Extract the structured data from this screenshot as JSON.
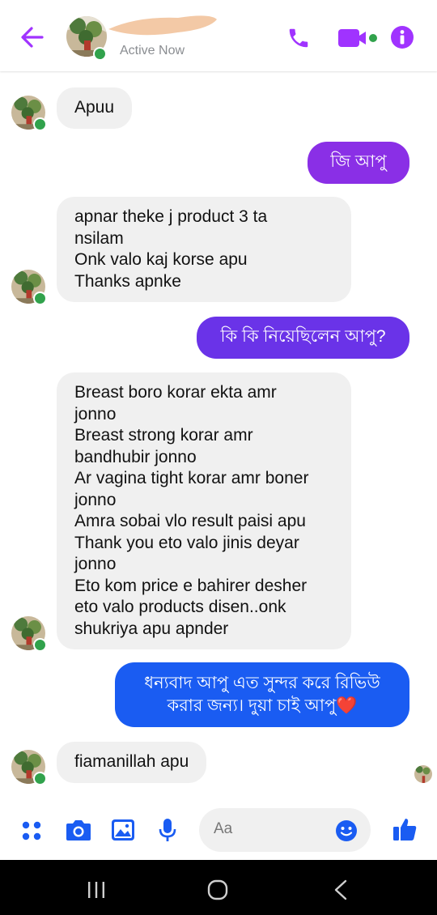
{
  "header": {
    "status": "Active Now"
  },
  "messages": [
    {
      "text": "Apuu"
    },
    {
      "text": "জি আপু"
    },
    {
      "text": "apnar theke j product 3 ta\nnsilam\nOnk valo kaj korse apu\nThanks apnke"
    },
    {
      "text": "কি কি নিয়েছিলেন আপু?"
    },
    {
      "text": "Breast boro korar ekta amr\njonno\nBreast strong korar amr\nbandhubir jonno\nAr vagina tight korar amr boner\njonno\nAmra sobai vlo result paisi apu\nThank you eto valo jinis deyar\njonno\nEto kom price e bahirer desher\neto valo products disen..onk\nshukriya apu apnder"
    },
    {
      "text": "ধন্যবাদ আপু এত সুন্দর করে রিভিউ\nকরার জন্য। দুয়া চাই আপু❤️"
    },
    {
      "text": "fiamanillah apu"
    }
  ],
  "composer": {
    "placeholder": "Aa"
  },
  "colors": {
    "accent": "#a033ff",
    "outgoing_purple": "#7b2be8",
    "outgoing_blue": "#1a5cf2",
    "online": "#31a24c"
  },
  "icons": [
    "back-arrow-icon",
    "phone-icon",
    "video-icon",
    "info-icon",
    "menu-dots-icon",
    "camera-icon",
    "gallery-icon",
    "mic-icon",
    "emoji-icon",
    "like-icon",
    "recents-icon",
    "home-icon",
    "nav-back-icon"
  ]
}
